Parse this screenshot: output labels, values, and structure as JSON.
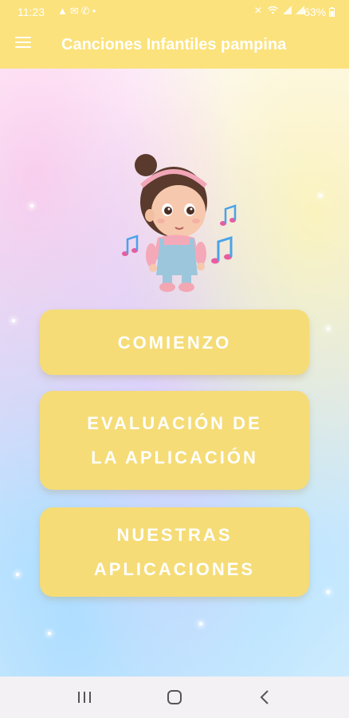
{
  "status_bar": {
    "time": "11:23",
    "battery": "63%",
    "left_icons": [
      "warning-icon",
      "mail-icon",
      "whatsapp-icon",
      "dot-icon"
    ],
    "right_icons": [
      "mute-icon",
      "wifi-icon",
      "signal-icon",
      "signal-icon",
      "battery-icon"
    ]
  },
  "app_bar": {
    "title": "Canciones Infantiles pampina",
    "menu_icon": "hamburger-menu-icon"
  },
  "buttons": {
    "start": "COMIENZO",
    "rate": "EVALUACIÓN DE\nLA APLICACIÓN",
    "apps": "NUESTRAS\nAPLICACIONES"
  },
  "nav_bar": {
    "items": [
      "recent-apps-icon",
      "home-icon",
      "back-icon"
    ]
  },
  "colors": {
    "app_bar": "#fbe27c",
    "button": "#f5dc77",
    "button_text": "#ffffff"
  }
}
